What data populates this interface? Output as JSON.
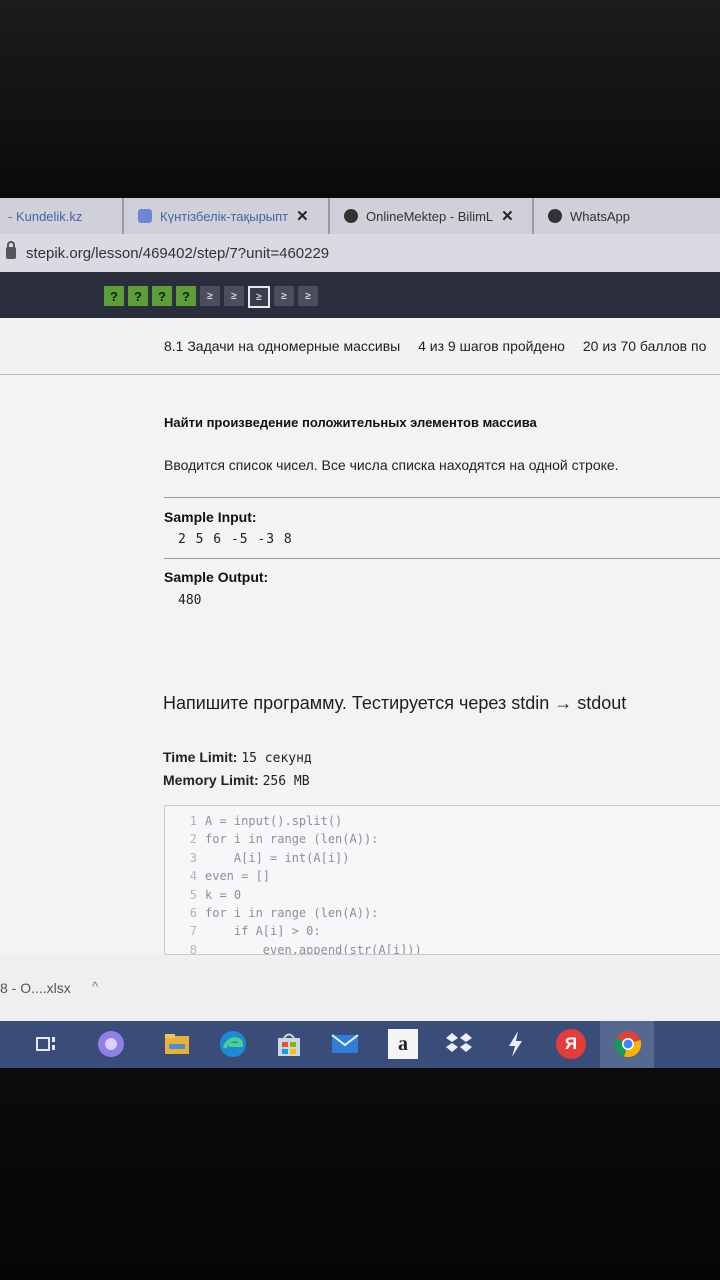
{
  "browser": {
    "tabs": [
      {
        "label": "- Kundelik.kz",
        "icon": "kundelik-icon",
        "color": "#4a76c8"
      },
      {
        "label": "Күнтізбелік-тақырыпт",
        "icon": "document-icon",
        "color": "#5a7bd1"
      },
      {
        "label": "OnlineMektep - BilimL",
        "icon": "onlinemektep-icon",
        "color": "#333333"
      },
      {
        "label": "WhatsApp",
        "icon": "whatsapp-icon",
        "color": "#333333"
      }
    ],
    "close_glyph": "✕",
    "url": "stepik.org/lesson/469402/step/7?unit=460229"
  },
  "stepper": {
    "steps": [
      "?",
      "?",
      "?",
      "?",
      "≥",
      "≥",
      "≥",
      "≥",
      "≥"
    ],
    "current_index": 6
  },
  "lesson": {
    "title": "8.1 Задачи на одномерные массивы",
    "progress": "4 из 9 шагов пройдено",
    "score": "20 из 70 баллов по"
  },
  "task": {
    "title": "Найти произведение положительных элементов массива",
    "description": "Вводится список чисел. Все числа списка находятся на одной строке.",
    "sample_input_label": "Sample Input:",
    "sample_input": "2 5 6 -5 -3 8",
    "sample_output_label": "Sample Output:",
    "sample_output": "480",
    "program_heading": "Напишите программу. Тестируется через stdin → stdout",
    "time_limit_label": "Time Limit:",
    "time_limit_value": "15 секунд",
    "memory_limit_label": "Memory Limit:",
    "memory_limit_value": "256 MB"
  },
  "editor": {
    "lines": [
      {
        "n": "1",
        "code": "A = input().split()"
      },
      {
        "n": "2",
        "code": "for i in range (len(A)):"
      },
      {
        "n": "3",
        "code": "    A[i] = int(A[i])"
      },
      {
        "n": "4",
        "code": "even = []"
      },
      {
        "n": "5",
        "code": "k = 0"
      },
      {
        "n": "6",
        "code": "for i in range (len(A)):"
      },
      {
        "n": "7",
        "code": "    if A[i] > 0:"
      },
      {
        "n": "8",
        "code": "        even.append(str(A[i]))"
      }
    ]
  },
  "downloads": {
    "file": "8 - О....xlsx",
    "chevron": "^"
  },
  "taskbar": {
    "icons": [
      "task-view-icon",
      "cortana-icon",
      "file-explorer-icon",
      "edge-icon",
      "store-icon",
      "mail-icon",
      "amazon-icon",
      "dropbox-icon",
      "lightning-app-icon",
      "yandex-icon",
      "chrome-icon"
    ],
    "amazon_glyph": "a",
    "yandex_glyph": "Я"
  }
}
